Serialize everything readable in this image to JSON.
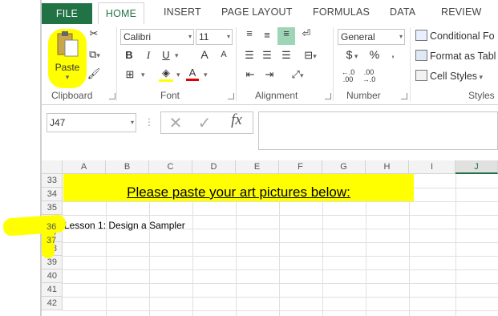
{
  "ribbon_tabs": [
    "FILE",
    "HOME",
    "INSERT",
    "PAGE LAYOUT",
    "FORMULAS",
    "DATA",
    "REVIEW"
  ],
  "clipboard": {
    "paste_label": "Paste",
    "group_label": "Clipboard"
  },
  "font": {
    "family": "Calibri",
    "size": "11",
    "group_label": "Font",
    "bold": "B",
    "italic": "I",
    "underline": "U",
    "grow": "A",
    "shrink": "A",
    "color_glyph": "A"
  },
  "alignment": {
    "group_label": "Alignment"
  },
  "number": {
    "format": "General",
    "currency": "$",
    "percent": "%",
    "comma": ",",
    "group_label": "Number"
  },
  "styles": {
    "conditional": "Conditional Fo",
    "format_table": "Format as Tabl",
    "cell_styles": "Cell Styles",
    "group_label": "Styles"
  },
  "formula_bar": {
    "name_box": "J47",
    "fx": "fx",
    "formula": ""
  },
  "columns": [
    "A",
    "B",
    "C",
    "D",
    "E",
    "F",
    "G",
    "H",
    "I",
    "J"
  ],
  "rows": [
    "33",
    "34",
    "35",
    "36",
    "37",
    "38",
    "39",
    "40",
    "41",
    "42"
  ],
  "cells": {
    "heading": "Please paste your art pictures below:",
    "lesson": "Lesson 1:  Design a Sampler"
  },
  "colors": {
    "excel_green": "#217346",
    "highlight": "#ffff00"
  }
}
